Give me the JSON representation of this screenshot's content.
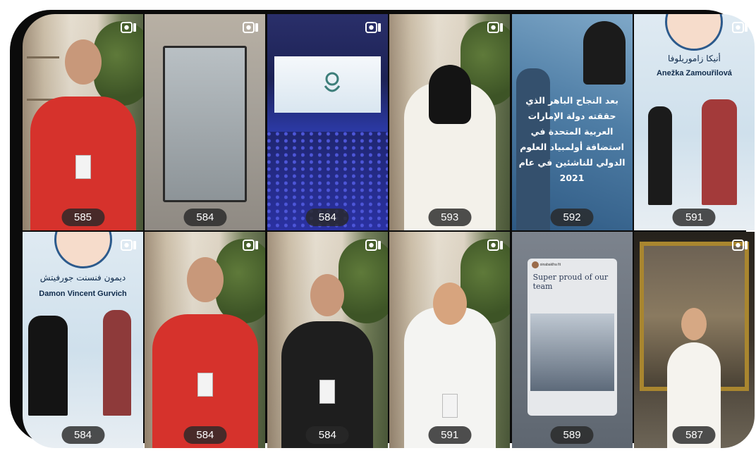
{
  "tiles": [
    {
      "count": "585",
      "kind": "reel"
    },
    {
      "count": "584",
      "kind": "reel"
    },
    {
      "count": "584",
      "kind": "reel"
    },
    {
      "count": "593",
      "kind": "reel"
    },
    {
      "count": "592",
      "kind": "reel",
      "overlay_text": "بعد النجاح الباهر الذي حققته دولة الإمارات العربية المتحدة في استضافة أولمبياد العلوم الدولي للناشئين في عام 2021"
    },
    {
      "count": "591",
      "kind": "reel",
      "name_ar": "أنيكا زاموريلوفا",
      "name_en": "Anežka Zamouřilová"
    },
    {
      "count": "584",
      "kind": "reel",
      "name_ar": "ديمون فنسنت جورفيتش",
      "name_en": "Damon Vincent Gurvich"
    },
    {
      "count": "584",
      "kind": "reel"
    },
    {
      "count": "584",
      "kind": "reel"
    },
    {
      "count": "591",
      "kind": "reel"
    },
    {
      "count": "589",
      "kind": "story",
      "handle": "oinabaklha fit",
      "caption": "Super proud of our team"
    },
    {
      "count": "587",
      "kind": "reel"
    }
  ],
  "icons": {
    "reel": "video-camera-icon"
  },
  "colors": {
    "frame": "#0b0b0b",
    "count_badge": "#282828"
  }
}
